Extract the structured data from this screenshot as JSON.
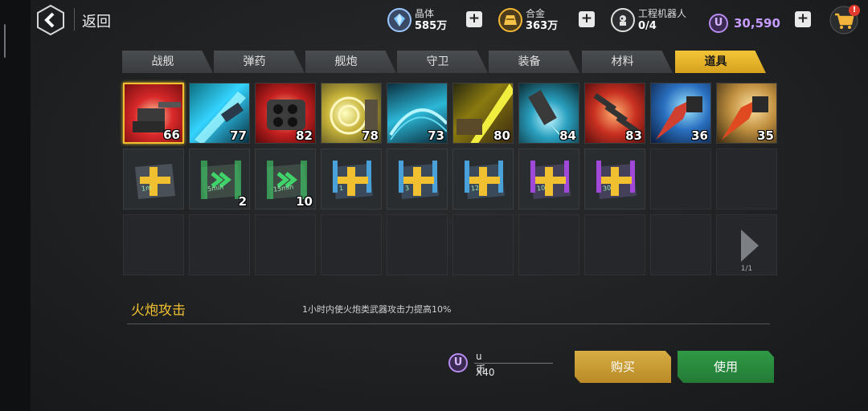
{
  "topbar": {
    "back_label": "返回",
    "resources": [
      {
        "name": "晶体",
        "value": "585万",
        "icon": "crystal-icon"
      },
      {
        "name": "合金",
        "value": "363万",
        "icon": "alloy-icon"
      },
      {
        "name": "工程机器人",
        "value": "0/4",
        "icon": "robot-icon"
      }
    ],
    "u_coin_symbol": "U",
    "u_coins": "30,590",
    "cart_badge": "!"
  },
  "tabs": [
    {
      "label": "战舰"
    },
    {
      "label": "弹药"
    },
    {
      "label": "舰炮"
    },
    {
      "label": "守卫"
    },
    {
      "label": "装备"
    },
    {
      "label": "材料"
    },
    {
      "label": "道具",
      "active": true
    }
  ],
  "items_row1": [
    {
      "count": "66",
      "icon": "cannon-attack-icon",
      "selected": true
    },
    {
      "count": "77",
      "icon": "laser-icon"
    },
    {
      "count": "82",
      "icon": "missile-launcher-icon"
    },
    {
      "count": "78",
      "icon": "target-icon"
    },
    {
      "count": "73",
      "icon": "shield-dome-icon"
    },
    {
      "count": "80",
      "icon": "gold-beam-icon"
    },
    {
      "count": "84",
      "icon": "drill-icon"
    },
    {
      "count": "83",
      "icon": "rockets-icon"
    },
    {
      "count": "36",
      "icon": "blue-rocket-icon"
    },
    {
      "count": "35",
      "icon": "orange-rocket-icon"
    }
  ],
  "items_row2": [
    {
      "count": "",
      "label": "1m",
      "color": "#f0c030",
      "icon": "gold-box-icon"
    },
    {
      "count": "2",
      "label": "5min",
      "color": "#3fd36a",
      "icon": "speedup-box-icon"
    },
    {
      "count": "10",
      "label": "15min",
      "color": "#3fd36a",
      "icon": "speedup-box-icon"
    },
    {
      "count": "",
      "label": "1",
      "color": "#f0c030",
      "icon": "blue-box-icon"
    },
    {
      "count": "",
      "label": "3",
      "color": "#f0c030",
      "icon": "blue-box-icon"
    },
    {
      "count": "",
      "label": "12",
      "color": "#f0c030",
      "icon": "blue-box-icon"
    },
    {
      "count": "",
      "label": "10",
      "color": "#f0c030",
      "icon": "purple-box-icon"
    },
    {
      "count": "",
      "label": "30",
      "color": "#f0c030",
      "icon": "purple-box-icon"
    }
  ],
  "pager": "1/1",
  "detail": {
    "title": "火炮攻击",
    "description": "1小时内使火炮类武器攻击力提高10%"
  },
  "price": {
    "symbol": "U",
    "currency": "u币",
    "quantity": "X40"
  },
  "buttons": {
    "buy": "购买",
    "use": "使用"
  },
  "colors": {
    "accent": "#f0c030",
    "buy": "#c99a30",
    "use": "#2a8a3e",
    "ucoin": "#b88cf0"
  }
}
